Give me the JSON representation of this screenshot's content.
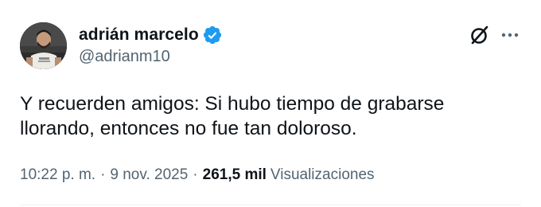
{
  "author": {
    "display_name": "adrián marcelo",
    "handle": "@adrianm10",
    "avatar_icon": "avatar-photo",
    "verified": true,
    "verified_icon": "verified-badge-icon"
  },
  "header_actions": {
    "grok_icon": "grok-icon",
    "more_icon": "more-options-icon"
  },
  "tweet": {
    "text_lines": [
      "Y recuerden amigos: Si hubo tiempo de grabarse",
      "llorando, entonces no fue tan doloroso."
    ]
  },
  "meta": {
    "time": "10:22 p. m.",
    "separator": "·",
    "date": "9 nov. 2025",
    "views_count": "261,5 mil",
    "views_label": "Visualizaciones"
  },
  "colors": {
    "text_primary": "#0f1419",
    "text_secondary": "#536471",
    "verified_blue": "#1d9bf0",
    "divider": "#eff3f4"
  }
}
